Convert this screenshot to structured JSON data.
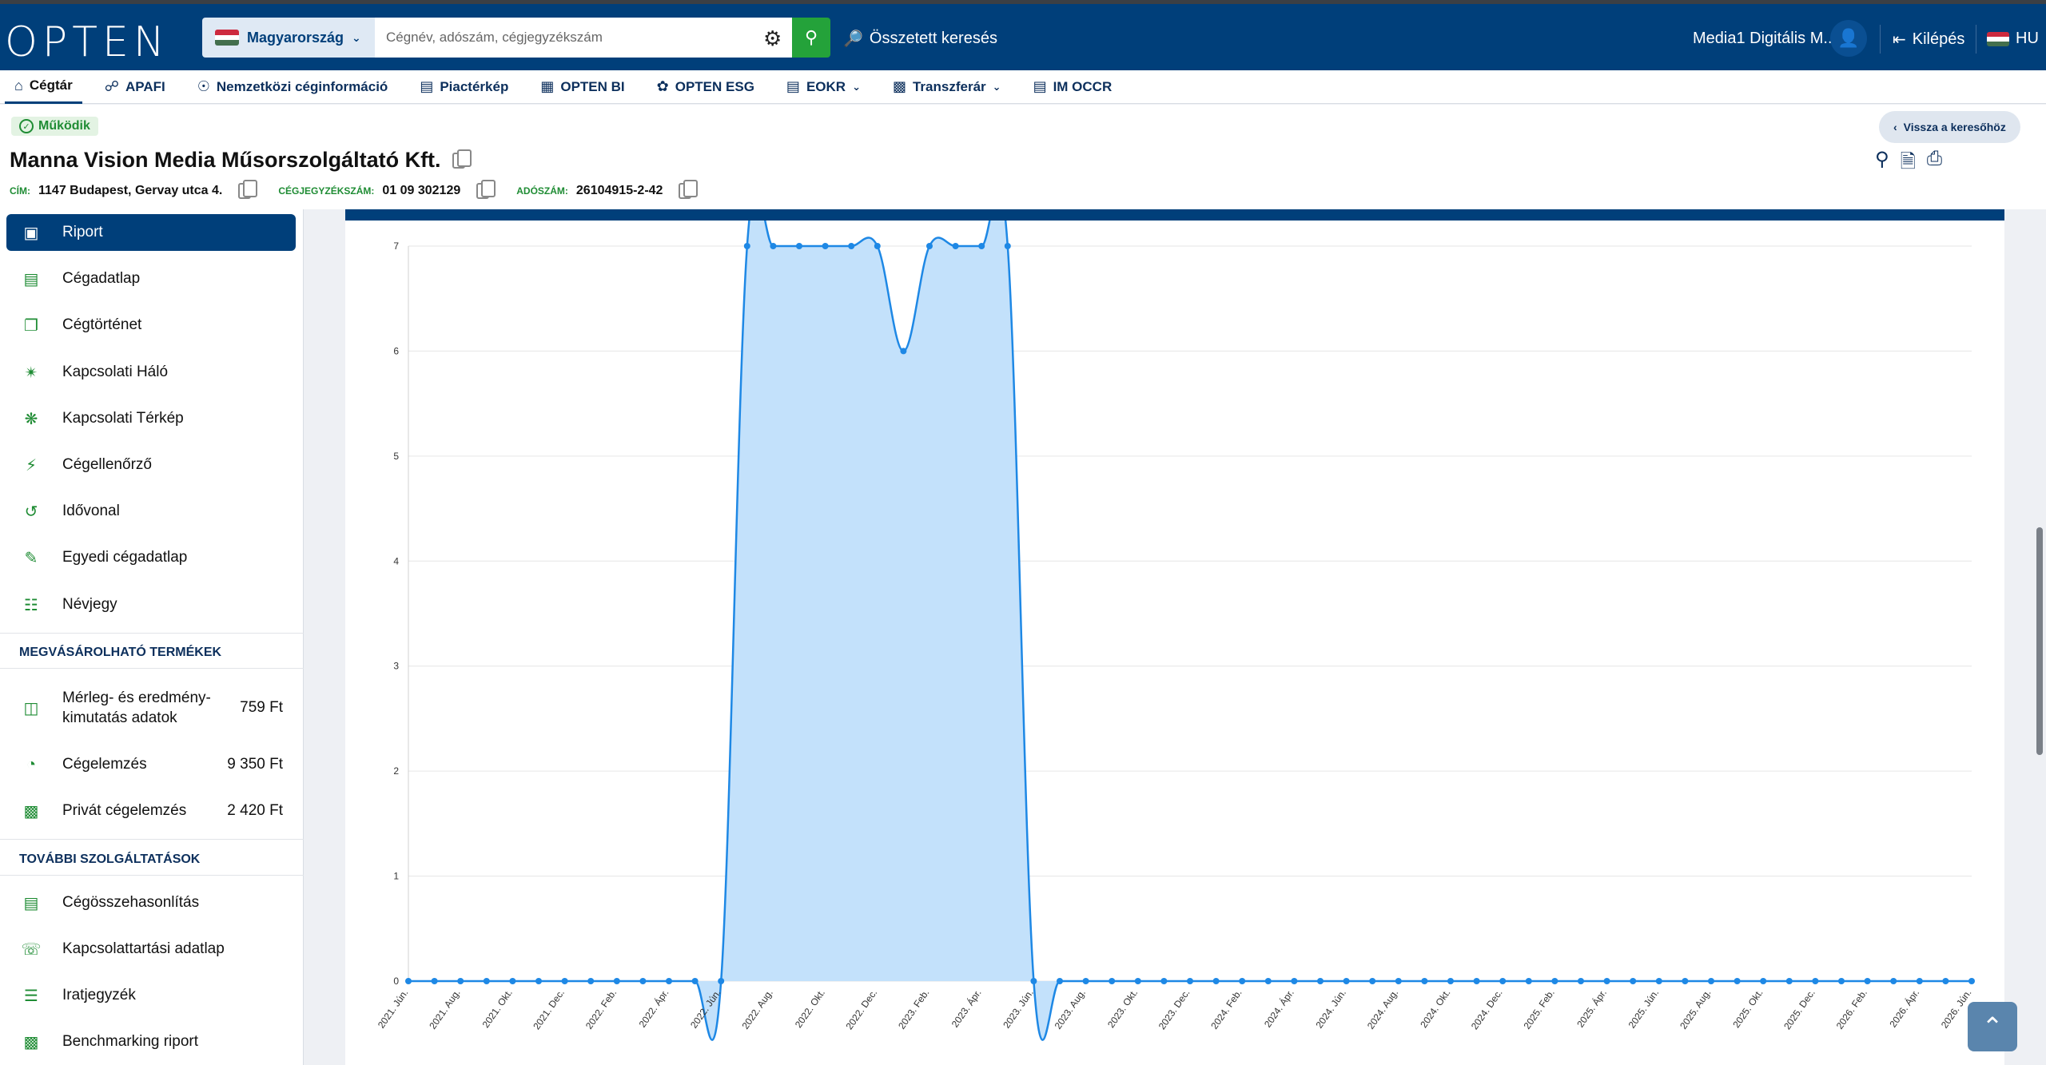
{
  "header": {
    "logo": "OPTEN",
    "country": "Magyarország",
    "search_placeholder": "Cégnév, adószám, cégjegyzékszám",
    "advanced_search": "Összetett keresés",
    "user_name": "Media1 Digitális M...",
    "logout": "Kilépés",
    "language": "HU"
  },
  "nav": {
    "items": [
      {
        "label": "Cégtár",
        "icon": "home-icon"
      },
      {
        "label": "APAFI",
        "icon": "binoculars-icon"
      },
      {
        "label": "Nemzetközi céginformáció",
        "icon": "globe-search-icon"
      },
      {
        "label": "Piactérkép",
        "icon": "map-icon"
      },
      {
        "label": "OPTEN BI",
        "icon": "dashboard-icon"
      },
      {
        "label": "OPTEN ESG",
        "icon": "leaf-icon"
      },
      {
        "label": "EOKR",
        "icon": "document-icon"
      },
      {
        "label": "Transzferár",
        "icon": "bar-chart-icon"
      },
      {
        "label": "IM OCCR",
        "icon": "report-icon"
      }
    ]
  },
  "company": {
    "status": "Működik",
    "name": "Manna Vision Media Műsorszolgáltató Kft.",
    "address_label": "CÍM:",
    "address": "1147 Budapest, Gervay utca 4.",
    "regno_label": "CÉGJEGYZÉKSZÁM:",
    "regno": "01 09 302129",
    "tax_label": "ADÓSZÁM:",
    "tax": "26104915-2-42",
    "back_button": "Vissza a keresőhöz"
  },
  "sidebar": {
    "items": [
      {
        "label": "Riport",
        "icon": "presentation-icon"
      },
      {
        "label": "Cégadatlap",
        "icon": "document-icon"
      },
      {
        "label": "Cégtörténet",
        "icon": "copy-icon"
      },
      {
        "label": "Kapcsolati Háló",
        "icon": "network-icon"
      },
      {
        "label": "Kapcsolati Térkép",
        "icon": "graph-icon"
      },
      {
        "label": "Cégellenőrző",
        "icon": "bolt-icon"
      },
      {
        "label": "Idővonal",
        "icon": "history-icon"
      },
      {
        "label": "Egyedi cégadatlap",
        "icon": "custom-doc-icon"
      },
      {
        "label": "Névjegy",
        "icon": "id-card-icon"
      }
    ],
    "section_purchasable": "MEGVÁSÁROLHATÓ TERMÉKEK",
    "purchasable": [
      {
        "label": "Mérleg- és eredmény-kimutatás adatok",
        "price": "759 Ft",
        "icon": "balance-icon"
      },
      {
        "label": "Cégelemzés",
        "price": "9 350 Ft",
        "icon": "pie-icon"
      },
      {
        "label": "Privát cégelemzés",
        "price": "2 420 Ft",
        "icon": "chart-lock-icon"
      }
    ],
    "section_more": "TOVÁBBI SZOLGÁLTATÁSOK",
    "more": [
      {
        "label": "Cégösszehasonlítás",
        "icon": "compare-icon"
      },
      {
        "label": "Kapcsolattartási adatlap",
        "icon": "phone-icon"
      },
      {
        "label": "Iratjegyzék",
        "icon": "layers-icon"
      },
      {
        "label": "Benchmarking riport",
        "icon": "bars-icon"
      }
    ]
  },
  "chart_data": {
    "type": "area",
    "ylim": [
      0,
      7
    ],
    "yticks": [
      0,
      1,
      2,
      3,
      4,
      5,
      6,
      7
    ],
    "x": [
      "2021. Jún.",
      "2021. Júl.",
      "2021. Aug.",
      "2021. Szept.",
      "2021. Okt.",
      "2021. Nov.",
      "2021. Dec.",
      "2022. Jan.",
      "2022. Feb.",
      "2022. Márc.",
      "2022. Ápr.",
      "2022. Máj.",
      "2022. Jún.",
      "2022. Júl.",
      "2022. Aug.",
      "2022. Szept.",
      "2022. Okt.",
      "2022. Nov.",
      "2022. Dec.",
      "2023. Jan.",
      "2023. Feb.",
      "2023. Márc.",
      "2023. Ápr.",
      "2023. Máj.",
      "2023. Jún.",
      "2023. Júl.",
      "2023. Aug.",
      "2023. Szept.",
      "2023. Okt.",
      "2023. Nov.",
      "2023. Dec.",
      "2024. Jan.",
      "2024. Feb.",
      "2024. Márc.",
      "2024. Ápr.",
      "2024. Máj.",
      "2024. Jún.",
      "2024. Júl.",
      "2024. Aug.",
      "2024. Szept.",
      "2024. Okt.",
      "2024. Nov.",
      "2024. Dec.",
      "2025. Jan.",
      "2025. Feb.",
      "2025. Márc.",
      "2025. Ápr.",
      "2025. Máj.",
      "2025. Jún.",
      "2025. Júl.",
      "2025. Aug.",
      "2025. Szept.",
      "2025. Okt.",
      "2025. Nov.",
      "2025. Dec.",
      "2026. Jan.",
      "2026. Feb.",
      "2026. Márc.",
      "2026. Ápr.",
      "2026. Máj.",
      "2026. Jún."
    ],
    "xtick_labels": [
      "2021. Jún.",
      "2021. Aug.",
      "2021. Okt.",
      "2021. Dec.",
      "2022. Feb.",
      "2022. Ápr.",
      "2022. Jún.",
      "2022. Aug.",
      "2022. Okt.",
      "2022. Dec.",
      "2023. Feb.",
      "2023. Ápr.",
      "2023. Jún.",
      "2023. Aug.",
      "2023. Okt.",
      "2023. Dec.",
      "2024. Feb.",
      "2024. Ápr.",
      "2024. Jún.",
      "2024. Aug.",
      "2024. Okt.",
      "2024. Dec.",
      "2025. Feb.",
      "2025. Ápr.",
      "2025. Jún.",
      "2025. Aug.",
      "2025. Okt.",
      "2025. Dec.",
      "2026. Feb.",
      "2026. Ápr.",
      "2026. Jún."
    ],
    "values": [
      0,
      0,
      0,
      0,
      0,
      0,
      0,
      0,
      0,
      0,
      0,
      0,
      0,
      7,
      7,
      7,
      7,
      7,
      7,
      6,
      7,
      7,
      7,
      7,
      0,
      0,
      0,
      0,
      0,
      0,
      0,
      0,
      0,
      0,
      0,
      0,
      0,
      0,
      0,
      0,
      0,
      0,
      0,
      0,
      0,
      0,
      0,
      0,
      0,
      0,
      0,
      0,
      0,
      0,
      0,
      0,
      0,
      0,
      0,
      0,
      0
    ],
    "grid": true,
    "line_color": "#1e88e5",
    "fill_color": "#c3e1fb"
  },
  "colors": {
    "brand": "#003f7a",
    "accent_green": "#24a23a"
  }
}
